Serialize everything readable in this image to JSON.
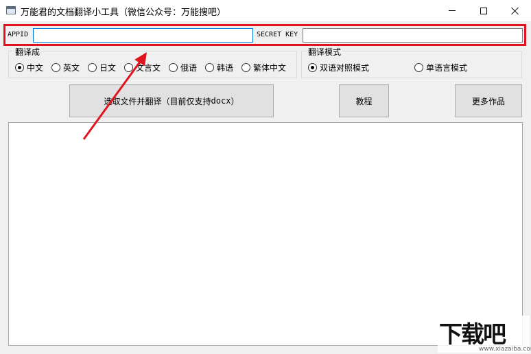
{
  "window": {
    "title": "万能君的文档翻译小工具（微信公众号：万能搜吧）",
    "icons": {
      "app": "window-app-icon",
      "minimize": "minimize-icon",
      "maximize": "maximize-icon",
      "close": "close-icon"
    }
  },
  "credentials": {
    "appid_label": "APPID",
    "appid_value": "",
    "secret_label": "SECRET KEY",
    "secret_value": "",
    "highlight_color": "#e0141e"
  },
  "translate_to": {
    "title": "翻译成",
    "options": [
      {
        "label": "中文",
        "checked": true
      },
      {
        "label": "英文",
        "checked": false
      },
      {
        "label": "日文",
        "checked": false
      },
      {
        "label": "文言文",
        "checked": false
      },
      {
        "label": "俄语",
        "checked": false
      },
      {
        "label": "韩语",
        "checked": false
      },
      {
        "label": "繁体中文",
        "checked": false
      }
    ]
  },
  "translate_mode": {
    "title": "翻译模式",
    "options": [
      {
        "label": "双语对照模式",
        "checked": true
      },
      {
        "label": "单语言模式",
        "checked": false
      }
    ]
  },
  "buttons": {
    "select_file_prefix": "选取文件并翻译（目前仅支持",
    "select_file_format": "docx",
    "select_file_suffix": "）",
    "tutorial": "教程",
    "more_works": "更多作品"
  },
  "output": {
    "text": ""
  },
  "annotation": {
    "arrow_color": "#e0141e"
  },
  "watermark": {
    "logo": "下载吧",
    "url": "www.xiazaiba.com"
  }
}
